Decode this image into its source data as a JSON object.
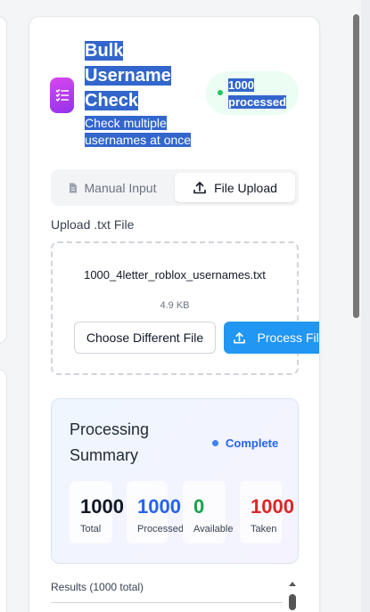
{
  "header": {
    "title": "Bulk Username Check",
    "subtitle": "Check multiple usernames at once",
    "badge": "1000 processed",
    "icon": "checklist-icon",
    "accent": "#c026d3"
  },
  "tabs": [
    {
      "label": "Manual Input",
      "icon": "document-icon",
      "active": false
    },
    {
      "label": "File Upload",
      "icon": "upload-icon",
      "active": true
    }
  ],
  "upload": {
    "label": "Upload .txt File",
    "file_name": "1000_4letter_roblox_usernames.txt",
    "file_size": "4.9 KB",
    "choose_button": "Choose Different File",
    "process_button": "Process File"
  },
  "summary": {
    "title": "Processing Summary",
    "status": "Complete",
    "stats": [
      {
        "value": "1000",
        "label": "Total",
        "color": "#111827"
      },
      {
        "value": "1000",
        "label": "Processed",
        "color": "#2563eb"
      },
      {
        "value": "0",
        "label": "Available",
        "color": "#16a34a"
      },
      {
        "value": "1000",
        "label": "Taken",
        "color": "#dc2626"
      }
    ]
  },
  "results": {
    "label": "Results (1000 total)"
  }
}
